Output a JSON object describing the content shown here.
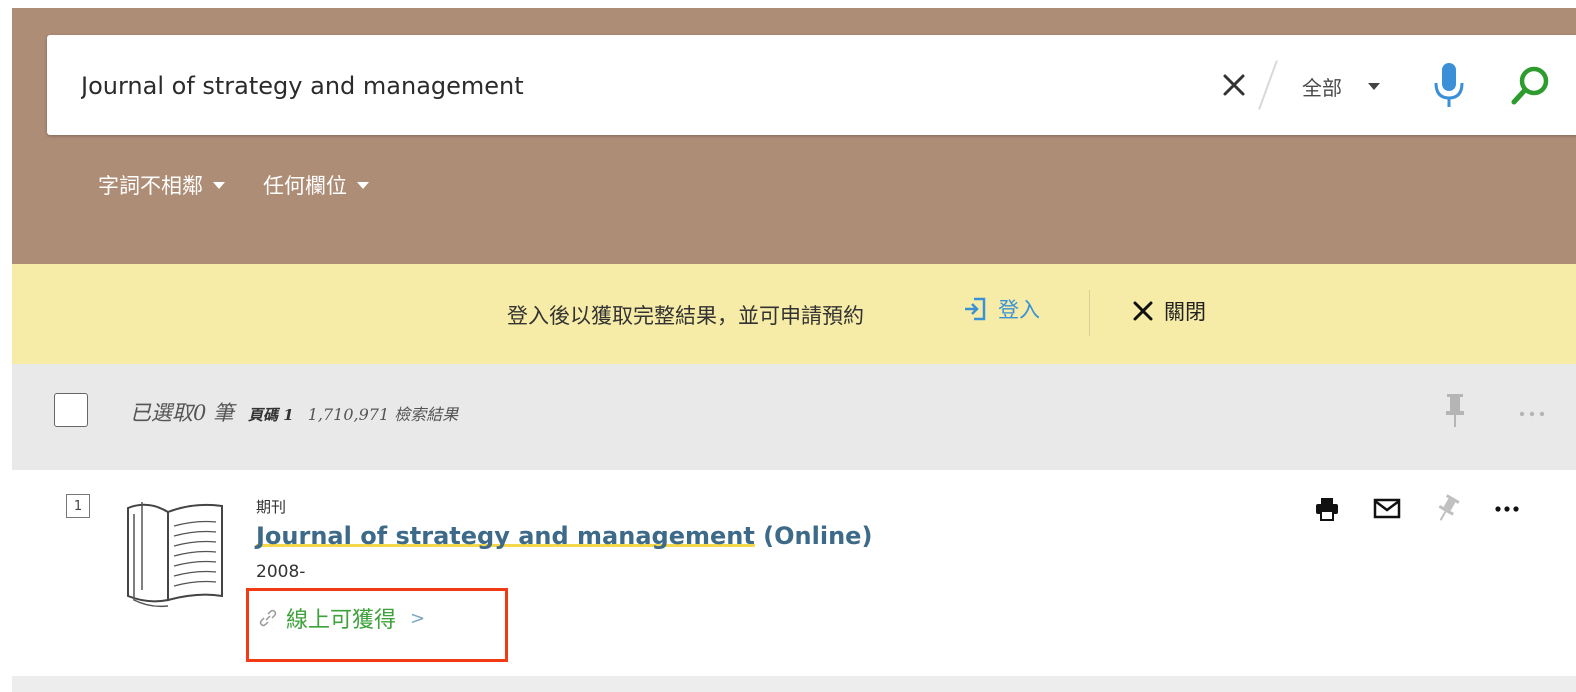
{
  "search": {
    "query": "Journal of strategy and management",
    "scope": "全部"
  },
  "filters": {
    "match": "字詞不相鄰",
    "field": "任何欄位"
  },
  "banner": {
    "message": "登入後以獲取完整結果，並可申請預約",
    "login": "登入",
    "close": "關閉"
  },
  "results": {
    "selected": "已選取0 筆",
    "page": "頁碼 1",
    "count": "1,710,971 檢索結果"
  },
  "items": [
    {
      "index": "1",
      "type": "期刊",
      "title_main": "Journal of strategy and management",
      "title_suffix": " (Online)",
      "date": "2008-",
      "availability": "線上可獲得",
      "chevron": ">"
    }
  ],
  "colors": {
    "header": "#ae8d76",
    "banner": "#f7eca7",
    "title": "#3d6a88",
    "available": "#3ea23b",
    "highlight_box": "#f23a14",
    "login_link": "#3a92d6"
  },
  "icons": {
    "clear": "close-icon",
    "microphone": "microphone-icon",
    "search": "search-icon",
    "login": "login-icon",
    "close": "close-icon",
    "pin": "pin-icon",
    "more": "more-icon",
    "print": "print-icon",
    "email": "email-icon",
    "link": "link-icon",
    "journal": "journal-book-icon"
  }
}
